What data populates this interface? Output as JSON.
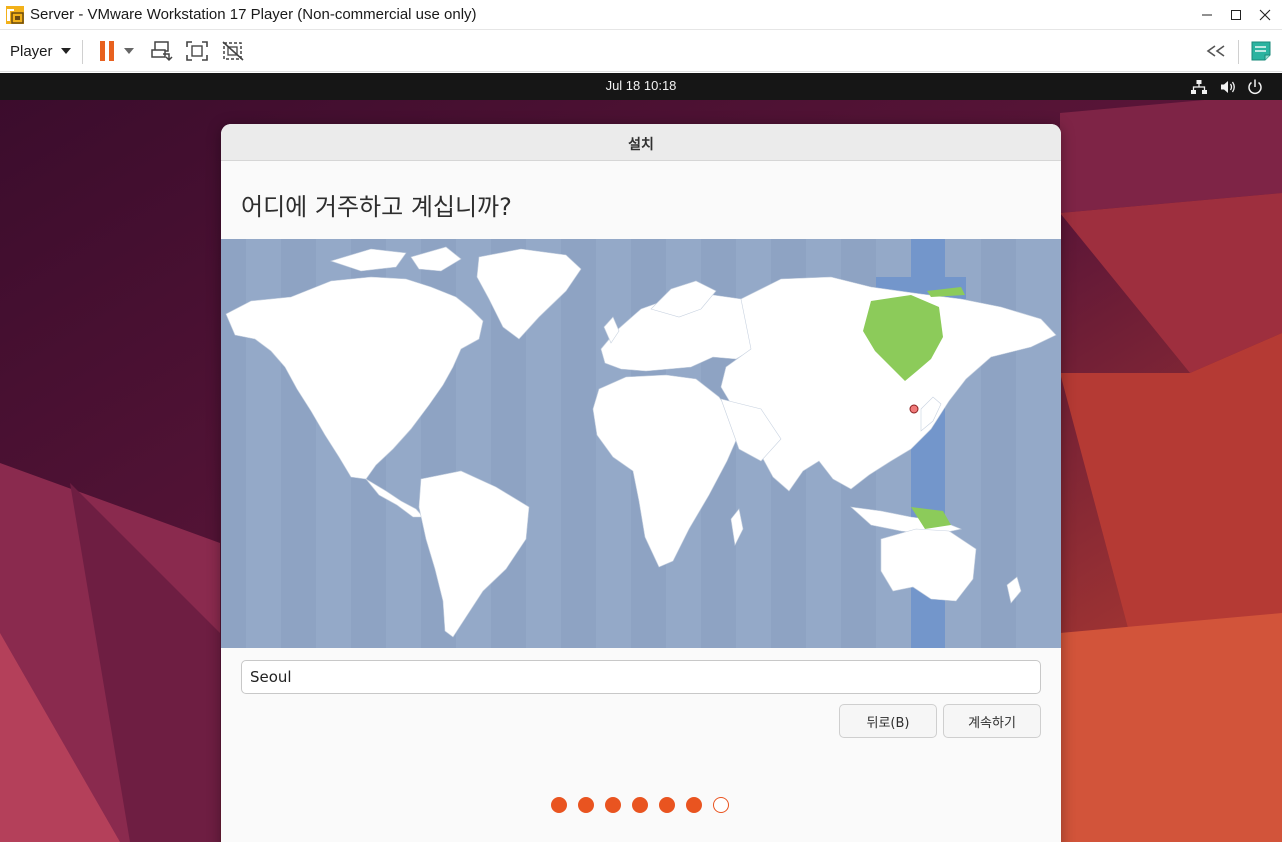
{
  "window": {
    "title": "Server - VMware Workstation 17 Player (Non-commercial use only)",
    "icons": {
      "app": "vmware-logo-icon",
      "minimize": "minimize-icon",
      "maximize": "maximize-icon",
      "close": "close-icon"
    }
  },
  "toolbar": {
    "player_label": "Player",
    "icons": [
      "pause-icon",
      "send-ctrl-alt-del-icon",
      "full-screen-icon",
      "unity-icon",
      "collapse-toolbar-icon",
      "notes-icon"
    ]
  },
  "guest": {
    "topbar": {
      "clock": "Jul 18  10:18",
      "icons": [
        "network-icon",
        "volume-icon",
        "power-icon"
      ]
    },
    "installer": {
      "window_title": "설치",
      "heading": "어디에 거주하고 계십니까?",
      "timezone_value": "Seoul",
      "back_button": "뒤로(B)",
      "continue_button": "계속하기",
      "progress": {
        "total_steps": 7,
        "completed_steps": 6
      },
      "selected_marker": "Seoul"
    }
  },
  "colors": {
    "accent": "#e95420",
    "map_ocean": "#94a9c8",
    "map_land": "#ffffff",
    "map_timezone_highlight": "#7396cb",
    "map_selected_region": "#8ccb5a",
    "topbar": "#161616"
  }
}
